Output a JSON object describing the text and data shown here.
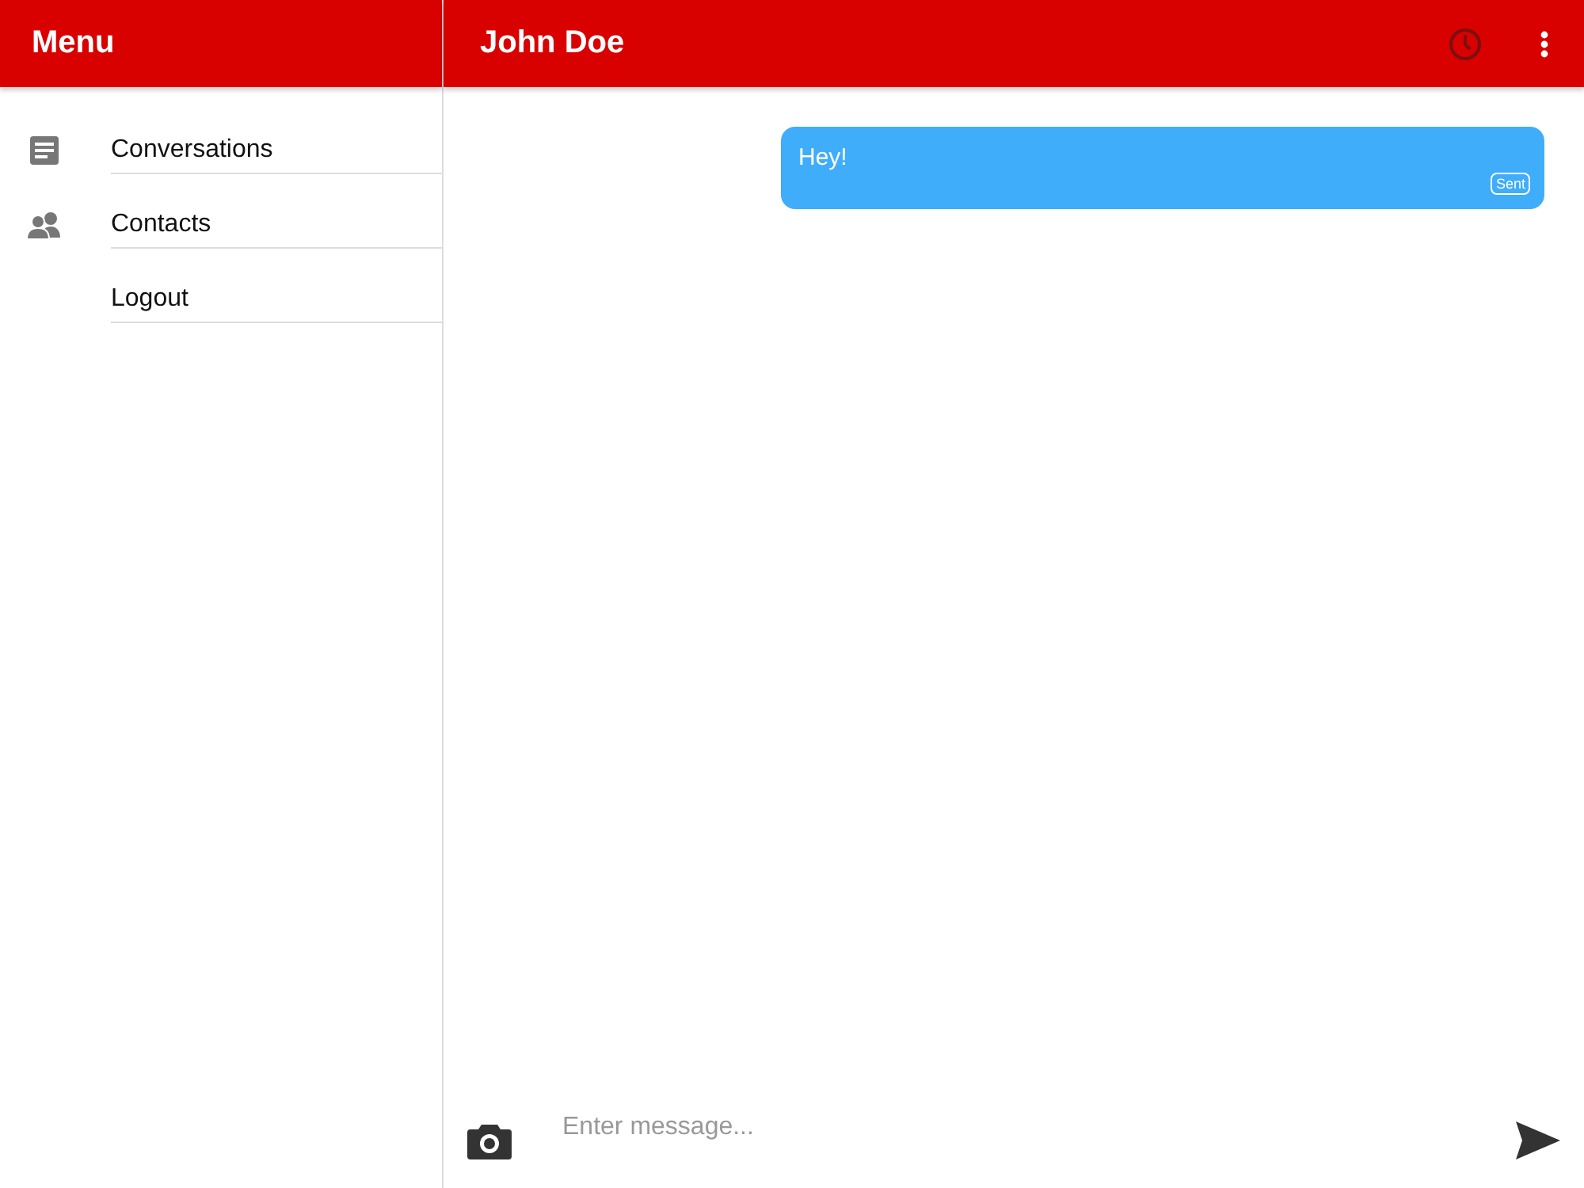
{
  "sidebar": {
    "title": "Menu",
    "items": [
      {
        "label": "Conversations"
      },
      {
        "label": "Contacts"
      },
      {
        "label": "Logout"
      }
    ]
  },
  "chat": {
    "title": "John Doe",
    "messages": [
      {
        "text": "Hey!",
        "status": "Sent"
      }
    ]
  },
  "composer": {
    "placeholder": "Enter message..."
  }
}
